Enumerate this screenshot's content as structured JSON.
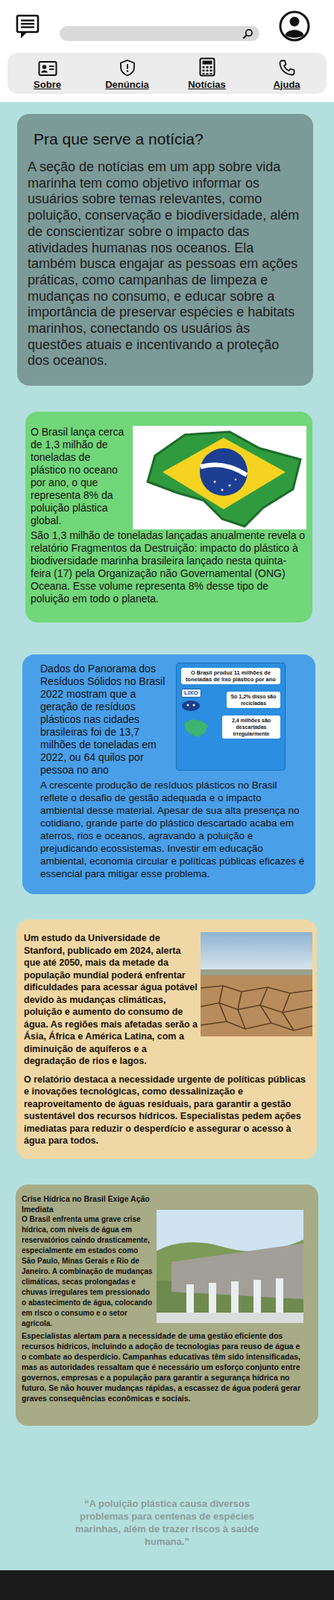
{
  "nav": [
    {
      "label": "Sobre",
      "kind": "about"
    },
    {
      "label": "Denúncia",
      "kind": "report"
    },
    {
      "label": "Notícias",
      "kind": "news"
    },
    {
      "label": "Ajuda",
      "kind": "help"
    }
  ],
  "intro": {
    "title": "Pra que serve a notícia?",
    "body": "A seção de notícias em um app sobre vida marinha tem como objetivo informar os usuários sobre temas relevantes, como poluição, conservação e biodiversidade, além de conscientizar sobre o impacto das atividades humanas nos oceanos. Ela também busca engajar as pessoas em ações práticas, como campanhas de limpeza e mudanças no consumo, e educar sobre a importância de preservar espécies e habitats marinhos, conectando os usuários às questões atuais e incentivando a proteção dos oceanos."
  },
  "news": [
    {
      "kind": "flag",
      "color": "#72d67a",
      "lead": "O Brasil lança cerca de 1,3 milhão de toneladas de plástico no oceano por ano, o que representa 8% da poluição plástica global.",
      "body": "São 1,3 milhão de toneladas lançadas anualmente revela o relatório Fragmentos da Destruição: impacto do plástico à biodiversidade marinha brasileira lançado nesta quinta-feira (17) pela Organização não Governamental (ONG) Oceana. Esse volume representa 8% desse tipo de poluição em todo o planeta."
    },
    {
      "kind": "infographic",
      "color": "#4a9fe9",
      "lead": "Dados do Panorama dos Resíduos Sólidos no Brasil 2022 mostram que a geração de resíduos plásticos nas cidades brasileiras foi de 13,7 milhões de toneladas em 2022, ou 64 quilos por pessoa no ano",
      "body": "A crescente produção de resíduos plásticos no Brasil reflete o desafio de gestão adequada e o impacto ambiental desse material. Apesar de sua alta presença no cotidiano, grande parte do plástico descartado acaba em aterros, rios e oceanos, agravando a poluição e prejudicando ecossistemas. Investir em educação ambiental, economia circular e políticas públicas eficazes é essencial para mitigar esse problema.",
      "graphic": {
        "title": "O Brasil produz 11 milhões de toneladas de lixo plástico por ano",
        "badge": "LIXO",
        "recycled": "Só 1,2% disso são recicladas",
        "irregular": "2,4 milhões são descartadas irregularmente"
      }
    },
    {
      "kind": "drought",
      "color": "#f0d8a6",
      "lead": "Um estudo da Universidade de Stanford, publicado em 2024, alerta que até 2050, mais da metade da população mundial poderá enfrentar dificuldades para acessar água potável devido às mudanças climáticas, poluição e aumento do consumo de água. As regiões mais afetadas serão a Ásia, África e América Latina, com a diminuição de aquíferos e a degradação de rios e lagos.",
      "body": "O relatório destaca a necessidade urgente de políticas públicas e inovações tecnológicas, como dessalinização e reaproveitamento de águas residuais, para garantir a gestão sustentável dos recursos hídricos. Especialistas pedem ações imediatas para reduzir o desperdício e assegurar o acesso à água para todos."
    },
    {
      "kind": "dam",
      "color": "#a7ab86",
      "title": "Crise Hídrica no Brasil Exige Ação Imediata",
      "lead": "O Brasil enfrenta uma grave crise hídrica, com níveis de água em reservatórios caindo drasticamente, especialmente em estados como São Paulo, Minas Gerais e Rio de Janeiro. A combinação de mudanças climáticas, secas prolongadas e chuvas irregulares tem pressionado o abastecimento de água, colocando em risco o consumo e o setor agrícola.",
      "body": "Especialistas alertam para a necessidade de uma gestão eficiente dos recursos hídricos, incluindo a adoção de tecnologias para reuso de água e o combate ao desperdício. Campanhas educativas têm sido intensificadas, mas as autoridades ressaltam que é necessário um esforço conjunto entre governos, empresas e a população para garantir a segurança hídrica no futuro. Se não houver mudanças rápidas, a escassez de água poderá gerar graves consequências econômicas e sociais."
    }
  ],
  "quote": "“A poluição plástica causa diversos problemas para centenas de espécies marinhas, além de trazer riscos à saúde humana.”"
}
